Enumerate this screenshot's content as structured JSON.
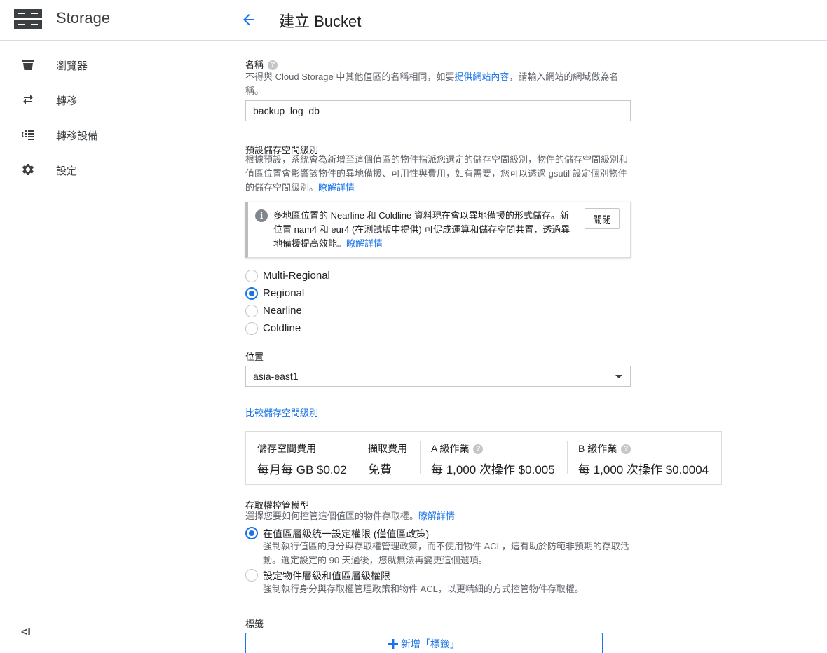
{
  "header": {
    "app_title": "Storage",
    "page_title": "建立 Bucket"
  },
  "sidebar": {
    "items": [
      {
        "label": "瀏覽器",
        "icon": "bucket-icon"
      },
      {
        "label": "轉移",
        "icon": "transfer-icon"
      },
      {
        "label": "轉移設備",
        "icon": "appliance-icon"
      },
      {
        "label": "設定",
        "icon": "gear-icon"
      }
    ],
    "collapse_label": "<I"
  },
  "name_section": {
    "label": "名稱",
    "desc_prefix": "不得與 Cloud Storage 中其他值區的名稱相同，如要",
    "desc_link": "提供網站內容",
    "desc_suffix": "，請輸入網站的網域做為名稱。",
    "value": "backup_log_db"
  },
  "storage_class": {
    "label": "預設儲存空間級別",
    "desc": "根據預設，系統會為新增至這個值區的物件指派您選定的儲存空間級別，物件的儲存空間級別和值區位置會影響該物件的異地備援、可用性與費用，如有需要，您可以透過 gsutil 設定個別物件的儲存空間級別。",
    "learn_more": "瞭解詳情",
    "info": {
      "text": "多地區位置的 Nearline 和 Coldline 資料現在會以異地備援的形式儲存。新位置 nam4 和 eur4 (在測試版中提供) 可促成運算和儲存空間共置，透過異地備援提高效能。",
      "link": "瞭解詳情",
      "close_label": "關閉"
    },
    "options": [
      {
        "label": "Multi-Regional",
        "checked": false
      },
      {
        "label": "Regional",
        "checked": true
      },
      {
        "label": "Nearline",
        "checked": false
      },
      {
        "label": "Coldline",
        "checked": false
      }
    ]
  },
  "location": {
    "label": "位置",
    "value": "asia-east1"
  },
  "compare_link": "比較儲存空間級別",
  "pricing": {
    "columns": [
      {
        "header": "儲存空間費用",
        "value": "每月每 GB $0.02",
        "help": false
      },
      {
        "header": "擷取費用",
        "value": "免費",
        "help": false
      },
      {
        "header": "A 級作業",
        "value": "每 1,000 次操作 $0.005",
        "help": true
      },
      {
        "header": "B 級作業",
        "value": "每 1,000 次操作 $0.0004",
        "help": true
      }
    ]
  },
  "access_control": {
    "label": "存取權控管模型",
    "desc": "選擇您要如何控管這個值區的物件存取權。",
    "learn_more": "瞭解詳情",
    "options": [
      {
        "label": "在值區層級統一設定權限 (僅值區政策)",
        "desc": "強制執行值區的身分與存取權管理政策，而不使用物件 ACL，這有助於防範非預期的存取活動。選定設定的 90 天過後，您就無法再變更這個選項。",
        "checked": true
      },
      {
        "label": "設定物件層級和值區層級權限",
        "desc": "強制執行身分與存取權管理政策和物件 ACL，以更精細的方式控管物件存取權。",
        "checked": false
      }
    ]
  },
  "labels": {
    "label": "標籤",
    "add_button": "新增「標籤」"
  }
}
